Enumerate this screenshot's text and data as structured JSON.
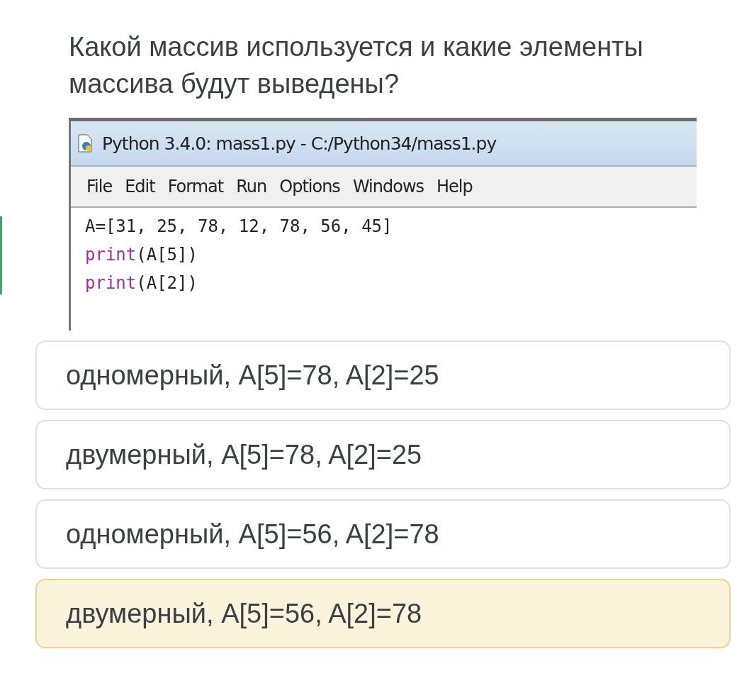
{
  "question": "Какой массив используется и какие элементы массива будут выведены?",
  "idle_window": {
    "title": "Python 3.4.0: mass1.py - C:/Python34/mass1.py",
    "menu": [
      "File",
      "Edit",
      "Format",
      "Run",
      "Options",
      "Windows",
      "Help"
    ],
    "code": [
      [
        {
          "kind": "plain",
          "text": "A=[31, 25, 78, 12, 78, 56, 45]"
        }
      ],
      [
        {
          "kind": "keyword",
          "text": "print"
        },
        {
          "kind": "plain",
          "text": "(A[5])"
        }
      ],
      [
        {
          "kind": "keyword",
          "text": "print"
        },
        {
          "kind": "plain",
          "text": "(A[2])"
        }
      ]
    ]
  },
  "options": [
    {
      "label": "одномерный, A[5]=78, A[2]=25",
      "selected": false
    },
    {
      "label": "двумерный, A[5]=78, A[2]=25",
      "selected": false
    },
    {
      "label": "одномерный, A[5]=56, A[2]=78",
      "selected": false
    },
    {
      "label": "двумерный, A[5]=56, A[2]=78",
      "selected": true
    }
  ]
}
